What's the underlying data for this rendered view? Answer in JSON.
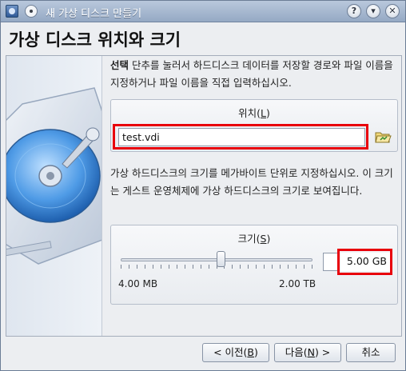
{
  "window": {
    "title": "새 가상 디스크 만들기",
    "controls": {
      "help": "?",
      "minimize": "▾",
      "close": "✕"
    }
  },
  "page": {
    "heading": "가상 디스크 위치와 크기",
    "intro_bold": "선택",
    "intro_text": " 단추를 눌러서 하드디스크 데이터를 저장할 경로와 파일 이름을 지정하거나 파일 이름을 직접 입력하십시오."
  },
  "location": {
    "group_title": "위치(",
    "group_mnemonic": "L",
    "group_title_end": ")",
    "value": "test.vdi",
    "folder_icon": "folder-open-icon"
  },
  "size": {
    "description": "가상 하드디스크의 크기를 메가바이트 단위로 지정하십시오. 이 크기는 게스트 운영체제에 가상 하드디스크의 크기로 보여집니다.",
    "group_title": "크기(",
    "group_mnemonic": "S",
    "group_title_end": ")",
    "value": "5.00 GB",
    "slider_min_label": "4.00 MB",
    "slider_max_label": "2.00 TB",
    "slider_position_fraction": 0.52
  },
  "buttons": {
    "back_prefix": "< 이전(",
    "back_mnemonic": "B",
    "back_suffix": ")",
    "next_prefix": "다음(",
    "next_mnemonic": "N",
    "next_suffix": ") >",
    "cancel": "취소"
  },
  "colors": {
    "highlight": "#e8000b",
    "titlebar": "#95a9c4"
  }
}
